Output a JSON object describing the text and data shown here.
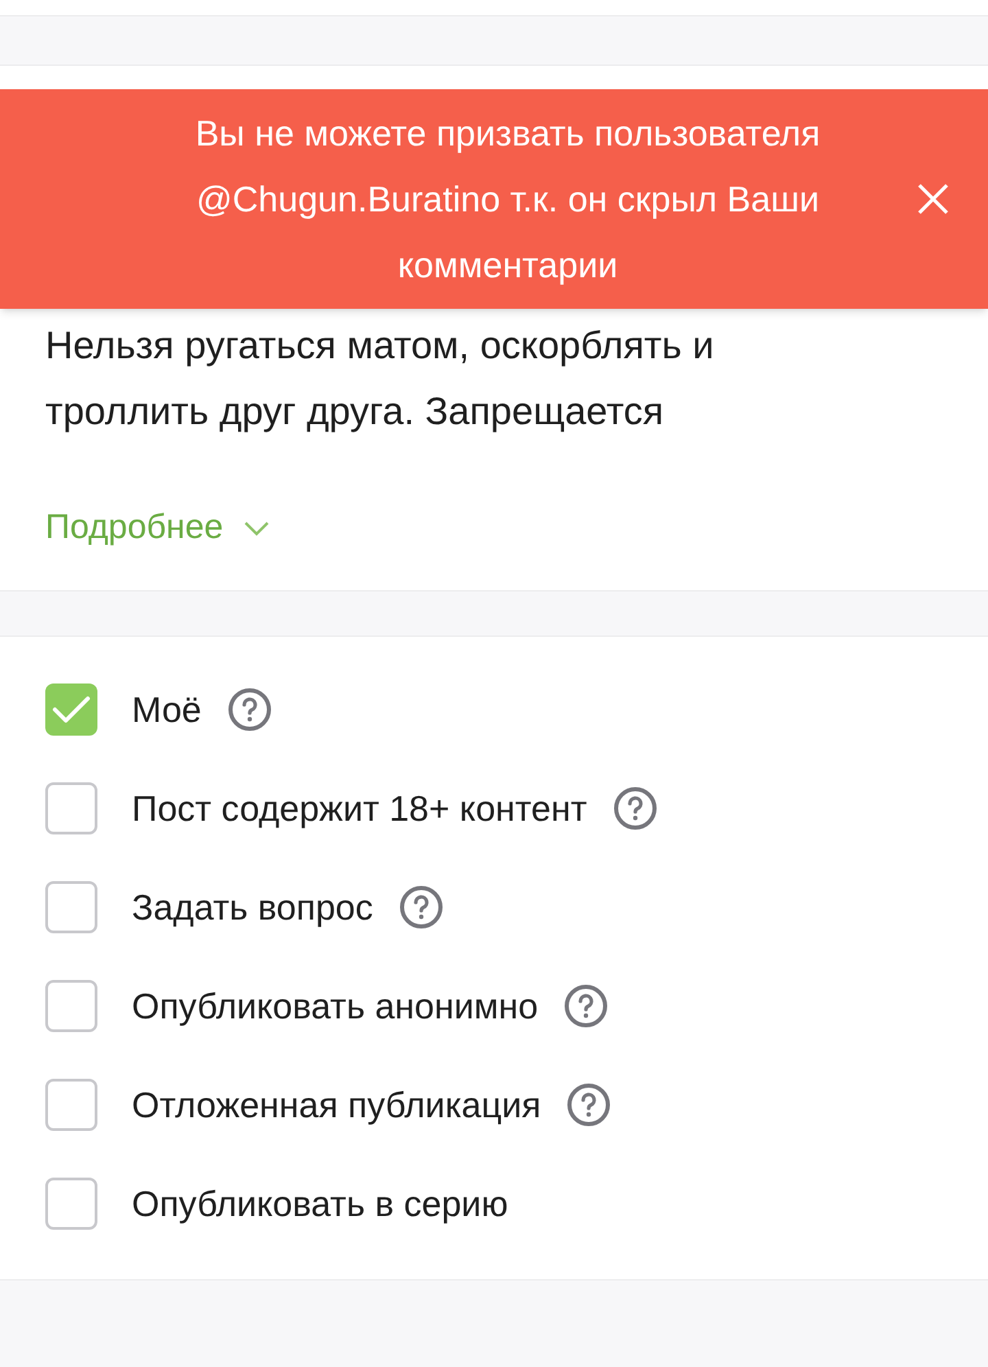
{
  "toast": {
    "message": "Вы не можете призвать пользователя @Chugun.Buratino т.к. он скрыл Ваши комментарии"
  },
  "rules": {
    "text": "Нельзя ругаться матом, оскорблять и троллить друг друга. Запрещается",
    "more_link": "Подробнее"
  },
  "options": [
    {
      "label": "Моё",
      "checked": true,
      "help": true
    },
    {
      "label": "Пост содержит 18+ контент",
      "checked": false,
      "help": true
    },
    {
      "label": "Задать вопрос",
      "checked": false,
      "help": true
    },
    {
      "label": "Опубликовать анонимно",
      "checked": false,
      "help": true
    },
    {
      "label": "Отложенная публикация",
      "checked": false,
      "help": true
    },
    {
      "label": "Опубликовать в серию",
      "checked": false,
      "help": false
    }
  ]
}
